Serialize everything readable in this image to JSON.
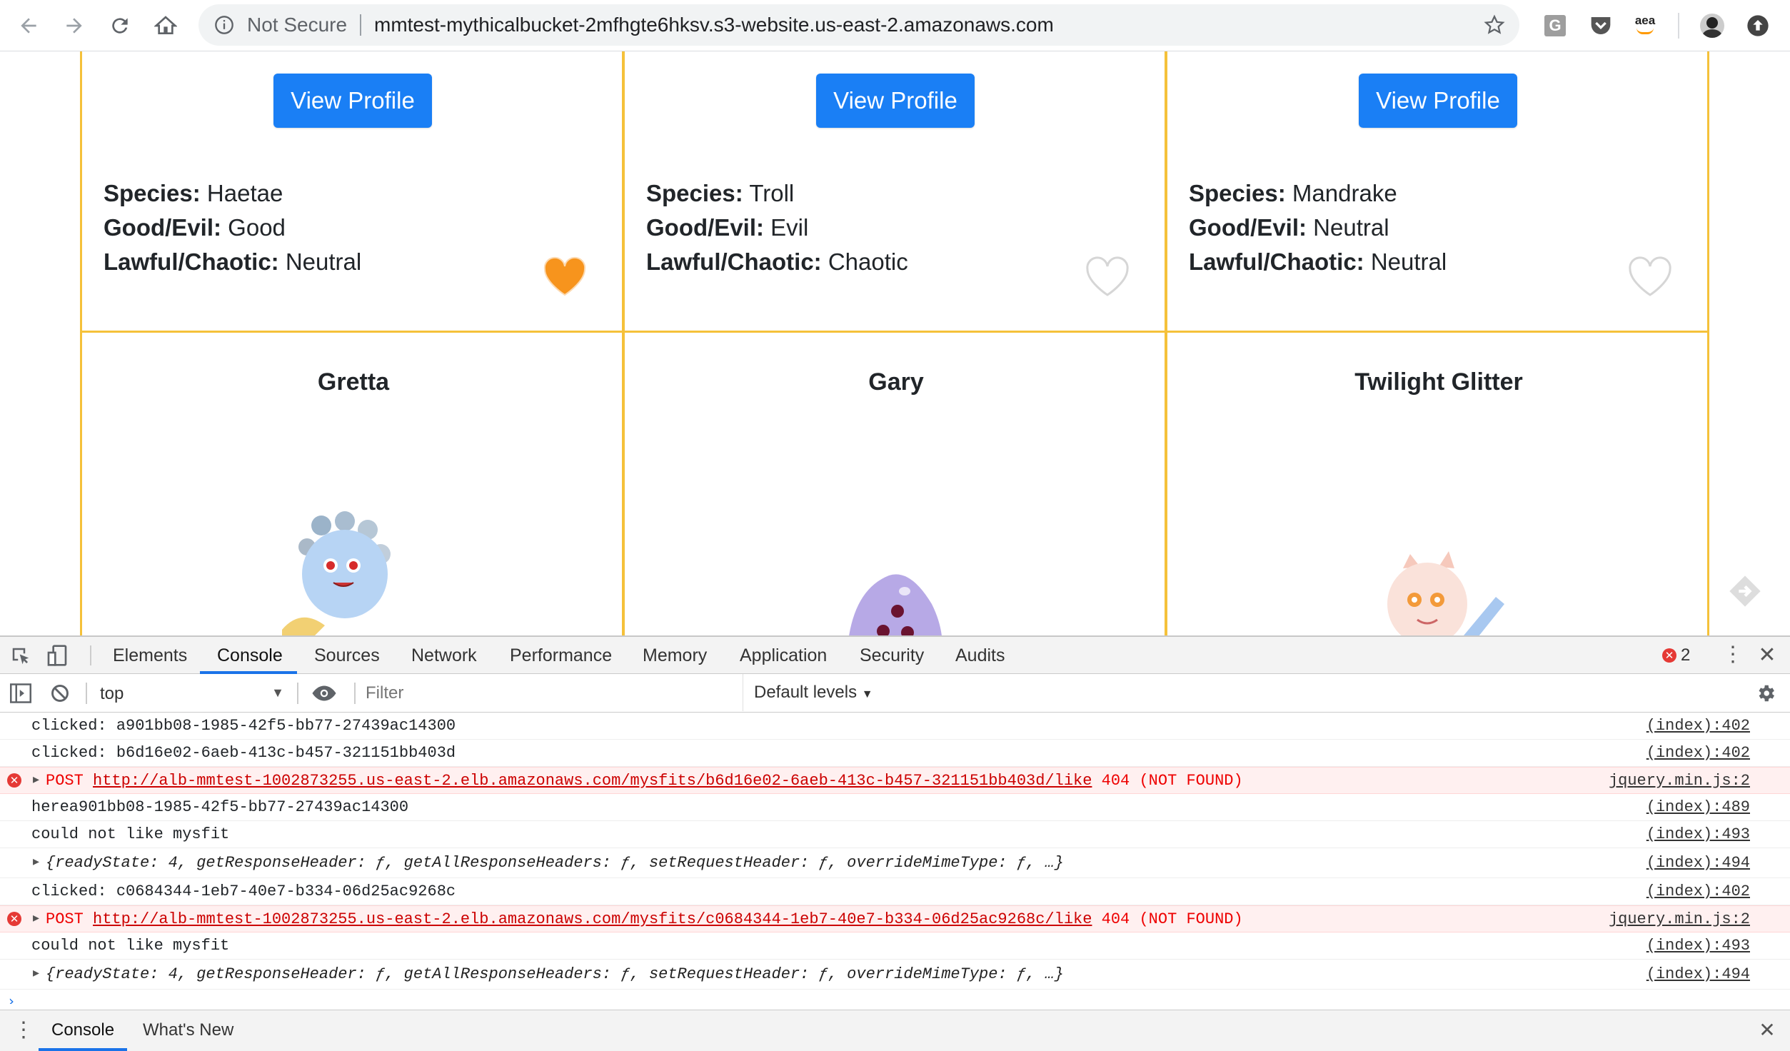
{
  "browser": {
    "security_label": "Not Secure",
    "url": "mmtest-mythicalbucket-2mfhgte6hksv.s3-website.us-east-2.amazonaws.com",
    "ext_amazon_label": "aea"
  },
  "cards_top": [
    {
      "button": "View Profile",
      "species_label": "Species:",
      "species": "Haetae",
      "good_label": "Good/Evil:",
      "good": "Good",
      "lawful_label": "Lawful/Chaotic:",
      "lawful": "Neutral",
      "liked": true
    },
    {
      "button": "View Profile",
      "species_label": "Species:",
      "species": "Troll",
      "good_label": "Good/Evil:",
      "good": "Evil",
      "lawful_label": "Lawful/Chaotic:",
      "lawful": "Chaotic",
      "liked": false
    },
    {
      "button": "View Profile",
      "species_label": "Species:",
      "species": "Mandrake",
      "good_label": "Good/Evil:",
      "good": "Neutral",
      "lawful_label": "Lawful/Chaotic:",
      "lawful": "Neutral",
      "liked": false
    }
  ],
  "cards_bottom": [
    {
      "name": "Gretta"
    },
    {
      "name": "Gary"
    },
    {
      "name": "Twilight Glitter"
    }
  ],
  "devtools": {
    "tabs": [
      "Elements",
      "Console",
      "Sources",
      "Network",
      "Performance",
      "Memory",
      "Application",
      "Security",
      "Audits"
    ],
    "active_tab": "Console",
    "error_count": "2",
    "context": "top",
    "filter_placeholder": "Filter",
    "levels": "Default levels",
    "drawer_tabs": [
      "Console",
      "What's New"
    ]
  },
  "console_rows": [
    {
      "type": "log",
      "text": "clicked: a901bb08-1985-42f5-bb77-27439ac14300",
      "source": "(index):402"
    },
    {
      "type": "log",
      "text": "clicked: b6d16e02-6aeb-413c-b457-321151bb403d",
      "source": "(index):402"
    },
    {
      "type": "error",
      "method": "POST",
      "url": "http://alb-mmtest-1002873255.us-east-2.elb.amazonaws.com/mysfits/b6d16e02-6aeb-413c-b457-321151bb403d/like",
      "status": "404 (NOT FOUND)",
      "source": "jquery.min.js:2"
    },
    {
      "type": "log",
      "text": "herea901bb08-1985-42f5-bb77-27439ac14300",
      "source": "(index):489"
    },
    {
      "type": "log",
      "text": "could not like mysfit",
      "source": "(index):493"
    },
    {
      "type": "object",
      "text": "{readyState: 4, getResponseHeader: ƒ, getAllResponseHeaders: ƒ, setRequestHeader: ƒ, overrideMimeType: ƒ, …}",
      "source": "(index):494"
    },
    {
      "type": "log",
      "text": "clicked: c0684344-1eb7-40e7-b334-06d25ac9268c",
      "source": "(index):402"
    },
    {
      "type": "error",
      "method": "POST",
      "url": "http://alb-mmtest-1002873255.us-east-2.elb.amazonaws.com/mysfits/c0684344-1eb7-40e7-b334-06d25ac9268c/like",
      "status": "404 (NOT FOUND)",
      "source": "jquery.min.js:2"
    },
    {
      "type": "log",
      "text": "could not like mysfit",
      "source": "(index):493"
    },
    {
      "type": "object",
      "text": "{readyState: 4, getResponseHeader: ƒ, getAllResponseHeaders: ƒ, setRequestHeader: ƒ, overrideMimeType: ƒ, …}",
      "source": "(index):494"
    }
  ],
  "colors": {
    "accent": "#1a7ff5",
    "card_border": "#f5c13a",
    "heart_liked": "#f7941d",
    "error": "#e00000"
  }
}
